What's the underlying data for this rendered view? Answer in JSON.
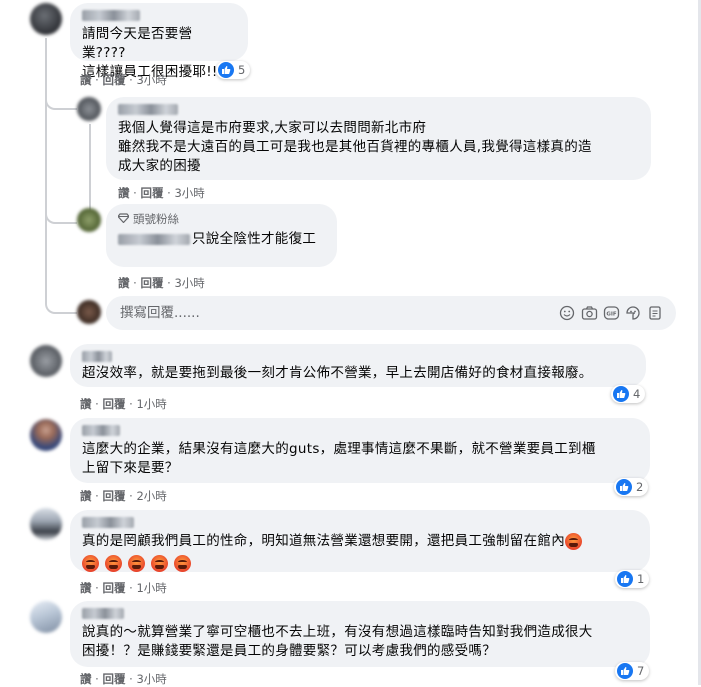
{
  "labels": {
    "like": "讚",
    "reply": "回覆",
    "sep": " · "
  },
  "comments": [
    {
      "id": "c1",
      "text": "請問今天是否要營業????\n這樣讓員工很困擾耶!!!",
      "time": "3小時",
      "likes": "5"
    },
    {
      "id": "r1",
      "text": "我個人覺得這是市府要求,大家可以去問問新北市府\n雖然我不是大遠百的員工可是我也是其他百貨裡的專櫃人員,我覺得這樣真的造\n成大家的困擾",
      "time": "3小時"
    },
    {
      "id": "r2",
      "badge": "頭號粉絲",
      "text": "只說全陰性才能復工",
      "time": "3小時"
    },
    {
      "id": "c2",
      "text": "超沒效率，就是要拖到最後一刻才肯公佈不營業，早上去開店備好的食材直接報廢。",
      "time": "1小時",
      "likes": "4"
    },
    {
      "id": "c3",
      "text": "這麼大的企業，結果沒有這麼大的guts，處理事情這麼不果斷，就不營業要員工到櫃\n上留下來是要？",
      "time": "2小時",
      "likes": "2"
    },
    {
      "id": "c4",
      "text": "真的是罔顧我們員工的性命，明知道無法營業還想要開，還把員工強制留在館內",
      "time": "1小時",
      "likes": "1"
    },
    {
      "id": "c5",
      "text": "說真的～就算營業了寧可空櫃也不去上班，有沒有想過這樣臨時告知對我們造成很大\n困擾！？是賺錢要緊還是員工的身體要緊？可以考慮我們的感受嗎？",
      "time": "3小時",
      "likes": "7"
    }
  ],
  "reply_box": {
    "placeholder": "撰寫回覆......"
  },
  "icons": [
    "smile-icon",
    "camera-icon",
    "gif-icon",
    "sticker-icon",
    "note-icon"
  ],
  "colors": {
    "bubble": "#f0f2f5",
    "like_blue": "#1877f2",
    "meta_gray": "#65676b"
  }
}
